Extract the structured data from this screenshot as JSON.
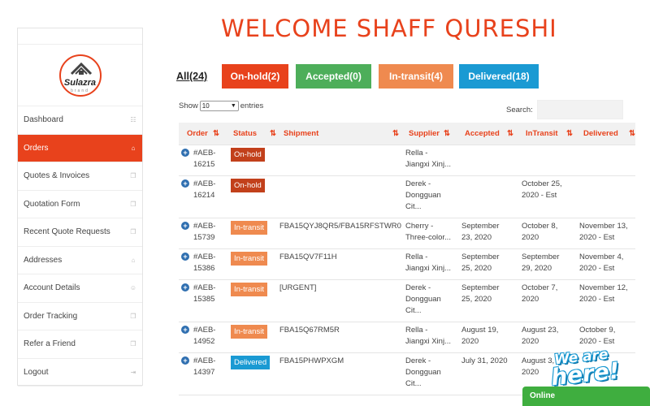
{
  "brand": {
    "name": "Sulazra",
    "tagline": "brand"
  },
  "sidebar": {
    "items": [
      {
        "label": "Dashboard",
        "icon": "dashboard-icon",
        "glyph": "☷"
      },
      {
        "label": "Orders",
        "icon": "basket-icon",
        "glyph": "⌂",
        "active": true
      },
      {
        "label": "Quotes & Invoices",
        "icon": "document-icon",
        "glyph": "❐"
      },
      {
        "label": "Quotation Form",
        "icon": "document-icon",
        "glyph": "❐"
      },
      {
        "label": "Recent Quote Requests",
        "icon": "document-icon",
        "glyph": "❐"
      },
      {
        "label": "Addresses",
        "icon": "home-icon",
        "glyph": "⌂"
      },
      {
        "label": "Account Details",
        "icon": "user-icon",
        "glyph": "☺"
      },
      {
        "label": "Order Tracking",
        "icon": "document-icon",
        "glyph": "❐"
      },
      {
        "label": "Refer a Friend",
        "icon": "document-icon",
        "glyph": "❐"
      },
      {
        "label": "Logout",
        "icon": "logout-icon",
        "glyph": "⇥"
      }
    ]
  },
  "header": {
    "title": "WELCOME SHAFF QURESHI"
  },
  "filters": [
    {
      "label": "All(24)",
      "kind": "all"
    },
    {
      "label": "On-hold(2)",
      "kind": "onhold"
    },
    {
      "label": "Accepted(0)",
      "kind": "accepted"
    },
    {
      "label": "In-transit(4)",
      "kind": "transit"
    },
    {
      "label": "Delivered(18)",
      "kind": "delivered"
    }
  ],
  "table_controls": {
    "show_label": "Show",
    "entries_value": "10",
    "entries_label": "entries",
    "search_label": "Search:"
  },
  "table": {
    "columns": [
      "Order",
      "Status",
      "Shipment",
      "Supplier",
      "Accepted",
      "InTransit",
      "Delivered"
    ],
    "rows": [
      {
        "order": [
          "#AEB-",
          "16215"
        ],
        "status": "On-hold",
        "status_kind": "onhold",
        "shipment": "",
        "supplier": [
          "Rella -",
          "Jiangxi Xinj..."
        ],
        "accepted": [],
        "intransit": [],
        "delivered": []
      },
      {
        "order": [
          "#AEB-",
          "16214"
        ],
        "status": "On-hold",
        "status_kind": "onhold",
        "shipment": "",
        "supplier": [
          "Derek -",
          "Dongguan",
          "Cit..."
        ],
        "accepted": [],
        "intransit": [
          "October 25,",
          "2020 - Est"
        ],
        "delivered": []
      },
      {
        "order": [
          "#AEB-",
          "15739"
        ],
        "status": "In-transit",
        "status_kind": "transit",
        "shipment": "FBA15QYJ8QR5/FBA15RFSTWR0",
        "supplier": [
          "Cherry -",
          "Three-color..."
        ],
        "accepted": [
          "September",
          "23, 2020"
        ],
        "intransit": [
          "October 8,",
          "2020"
        ],
        "delivered": [
          "November 13,",
          "2020 - Est"
        ]
      },
      {
        "order": [
          "#AEB-",
          "15386"
        ],
        "status": "In-transit",
        "status_kind": "transit",
        "shipment": "FBA15QV7F11H",
        "supplier": [
          "Rella -",
          "Jiangxi Xinj..."
        ],
        "accepted": [
          "September",
          "25, 2020"
        ],
        "intransit": [
          "September",
          "29, 2020"
        ],
        "delivered": [
          "November 4,",
          "2020 - Est"
        ]
      },
      {
        "order": [
          "#AEB-",
          "15385"
        ],
        "status": "In-transit",
        "status_kind": "transit",
        "shipment": "[URGENT]",
        "supplier": [
          "Derek -",
          "Dongguan",
          "Cit..."
        ],
        "accepted": [
          "September",
          "25, 2020"
        ],
        "intransit": [
          "October 7,",
          "2020"
        ],
        "delivered": [
          "November 12,",
          "2020 - Est"
        ]
      },
      {
        "order": [
          "#AEB-",
          "14952"
        ],
        "status": "In-transit",
        "status_kind": "transit",
        "shipment": "FBA15Q67RM5R",
        "supplier": [
          "Rella -",
          "Jiangxi Xinj..."
        ],
        "accepted": [
          "August 19,",
          "2020"
        ],
        "intransit": [
          "August 23,",
          "2020"
        ],
        "delivered": [
          "October 9,",
          "2020 - Est"
        ]
      },
      {
        "order": [
          "#AEB-",
          "14397"
        ],
        "status": "Delivered",
        "status_kind": "delivered",
        "shipment": "FBA15PHWPXGM",
        "supplier": [
          "Derek -",
          "Dongguan",
          "Cit..."
        ],
        "accepted": [
          "July 31, 2020"
        ],
        "intransit": [
          "August 3,",
          "2020"
        ],
        "delivered": []
      }
    ]
  },
  "chat": {
    "badge_line1": "We are",
    "badge_line2": "here!",
    "status": "Online"
  },
  "colors": {
    "accent": "#e8421c",
    "accepted": "#4dae5a",
    "transit": "#ef8a4f",
    "delivered": "#1a9ad3",
    "chat": "#3fae3f"
  }
}
